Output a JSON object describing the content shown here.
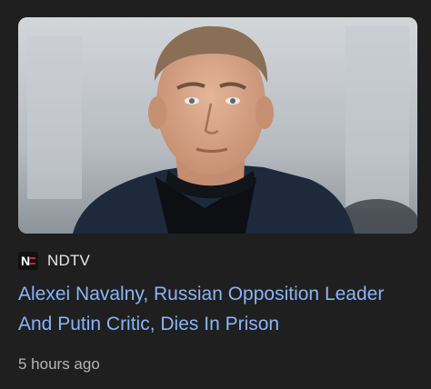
{
  "card": {
    "source": {
      "name": "NDTV",
      "logo_text": "N",
      "logo_colors": {
        "background": "#111111",
        "letter": "#ffffff",
        "accent": "#e02020"
      }
    },
    "headline": "Alexei Navalny, Russian Opposition Leader And Putin Critic, Dies In Prison",
    "timestamp": "5 hours ago",
    "image": {
      "semantic": "news-photo-portrait",
      "colors": {
        "background": "#c2c6ca",
        "skin": "#d9a98c",
        "jacket": "#1e2a3c"
      }
    }
  },
  "colors": {
    "page_background": "#1f1f1f",
    "headline_link": "#8ab4f8",
    "source_text": "#e8e8e8",
    "meta_text": "#b5b5b5"
  }
}
